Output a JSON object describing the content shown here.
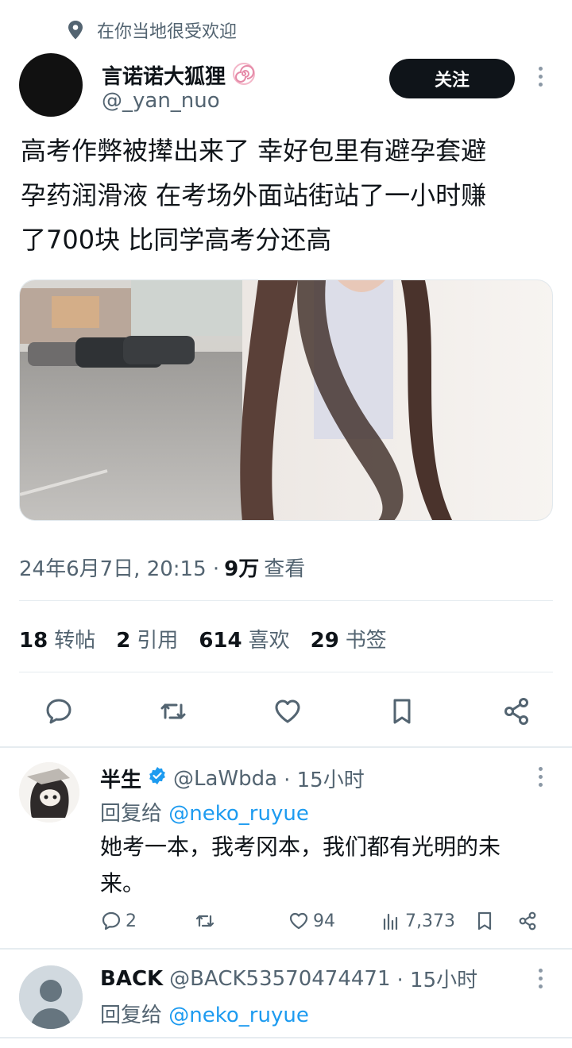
{
  "context": {
    "icon": "location-pin-icon",
    "text": "在你当地很受欢迎"
  },
  "author": {
    "display_name": "言诺诺大狐狸",
    "badge_icon": "naruto-swirl-icon",
    "handle": "@_yan_nuo",
    "avatar": "black-avatar"
  },
  "follow_label": "关注",
  "tweet_lines": [
    "高考作弊被撵出来了 幸好包里有避孕套避",
    "孕药润滑液 在考场外面站街站了一小时赚",
    "了700块 比同学高考分还高"
  ],
  "meta": {
    "datetime": "24年6月7日, 20:15 ·",
    "views": "9万",
    "views_label": "查看"
  },
  "stats": [
    {
      "num": "18",
      "label": "转帖"
    },
    {
      "num": "2",
      "label": "引用"
    },
    {
      "num": "614",
      "label": "喜欢"
    },
    {
      "num": "29",
      "label": "书签"
    }
  ],
  "action_icons": [
    "reply-icon",
    "retweet-icon",
    "like-icon",
    "bookmark-icon",
    "share-icon"
  ],
  "replies": [
    {
      "name": "半生",
      "verified_icon": "verified-badge-icon",
      "handle": "@LaWbda",
      "time": "· 15小时",
      "reply_to_prefix": "回复给",
      "reply_to": "@neko_ruyue",
      "text_lines": [
        "她考一本，我考冈本，我们都有光明的未",
        "来。"
      ],
      "counts": {
        "replies": "2",
        "retweets": "",
        "likes": "94",
        "views": "7,373"
      }
    },
    {
      "name": "BACK",
      "handle": "@BACK53570474471",
      "time": "· 15小时",
      "reply_to_prefix": "回复给",
      "reply_to": "@neko_ruyue"
    }
  ],
  "colors": {
    "accent": "#1d9bf0",
    "text": "#0f1419",
    "muted": "#536471",
    "button": "#0f1419"
  }
}
